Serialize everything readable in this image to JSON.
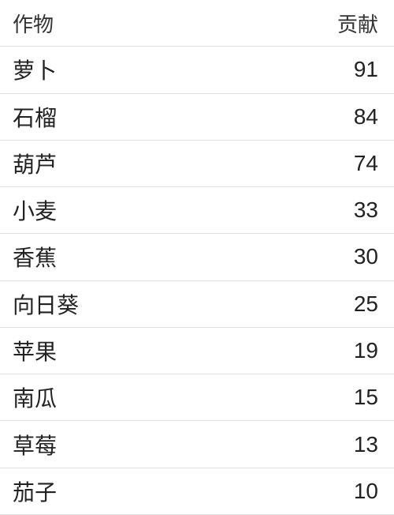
{
  "table": {
    "header": {
      "col1": "作物",
      "col2": "贡献"
    },
    "rows": [
      {
        "crop": "萝卜",
        "value": "91"
      },
      {
        "crop": "石榴",
        "value": "84"
      },
      {
        "crop": "葫芦",
        "value": "74"
      },
      {
        "crop": "小麦",
        "value": "33"
      },
      {
        "crop": "香蕉",
        "value": "30"
      },
      {
        "crop": "向日葵",
        "value": "25"
      },
      {
        "crop": "苹果",
        "value": "19"
      },
      {
        "crop": "南瓜",
        "value": "15"
      },
      {
        "crop": "草莓",
        "value": "13"
      },
      {
        "crop": "茄子",
        "value": "10"
      }
    ]
  }
}
